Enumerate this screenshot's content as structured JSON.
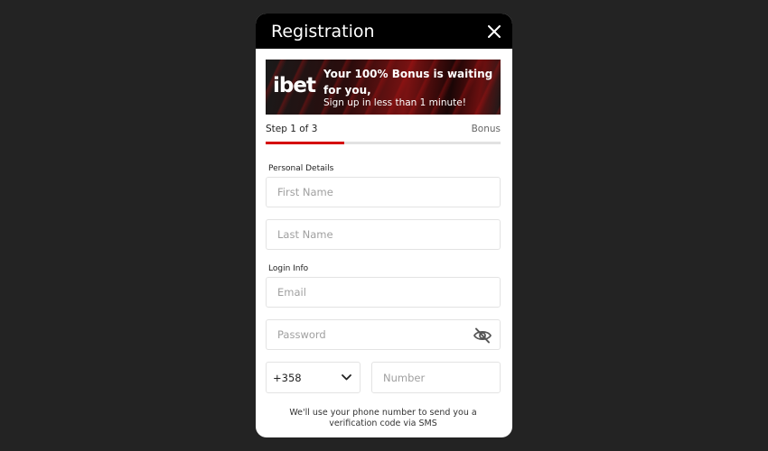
{
  "modal": {
    "title": "Registration",
    "close_icon": "close-icon"
  },
  "banner": {
    "logo": "ibet",
    "headline": "Your 100% Bonus is waiting for you,",
    "subtext": "Sign up in less than 1 minute!"
  },
  "steps": {
    "current_label": "Step 1 of 3",
    "next_label": "Bonus",
    "progress_fraction": 0.333,
    "accent_color": "#d50000"
  },
  "personal": {
    "section_label": "Personal Details",
    "first_name_placeholder": "First Name",
    "last_name_placeholder": "Last Name"
  },
  "login": {
    "section_label": "Login Info",
    "email_placeholder": "Email",
    "password_placeholder": "Password",
    "password_toggle_icon": "eye-off-icon"
  },
  "phone": {
    "country_code": "+358",
    "number_placeholder": "Number",
    "note": "We'll use your phone number to send you a verification code via SMS"
  }
}
